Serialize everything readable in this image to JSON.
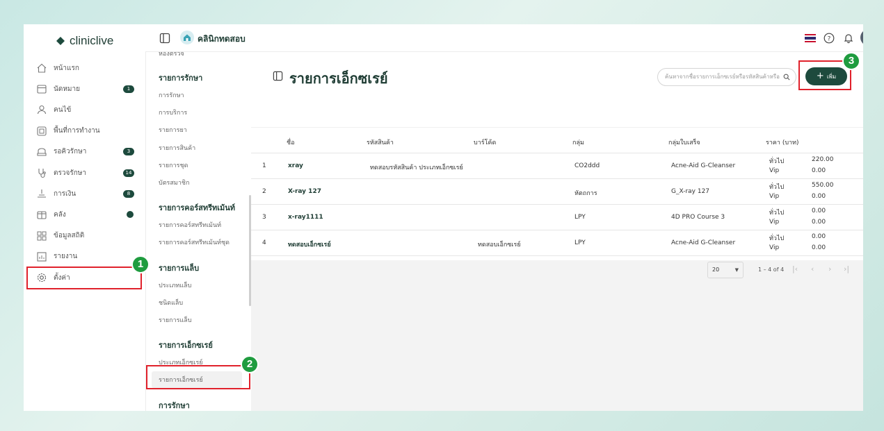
{
  "brand": {
    "name": "cliniclive"
  },
  "topbar": {
    "clinic_name": "คลินิกทดสอบ"
  },
  "sidebar": {
    "items": [
      {
        "label": "หน้าแรก",
        "icon": "home-icon",
        "badge": ""
      },
      {
        "label": "นัดหมาย",
        "icon": "calendar-icon",
        "badge": "1"
      },
      {
        "label": "คนไข้",
        "icon": "user-icon",
        "badge": ""
      },
      {
        "label": "พื้นที่การทำงาน",
        "icon": "workspace-icon",
        "badge": ""
      },
      {
        "label": "รอคิวรักษา",
        "icon": "seat-icon",
        "badge": "3"
      },
      {
        "label": "ตรวจรักษา",
        "icon": "stethoscope-icon",
        "badge": "14"
      },
      {
        "label": "การเงิน",
        "icon": "finance-icon",
        "badge": "8"
      },
      {
        "label": "คลัง",
        "icon": "storage-icon",
        "badge": ""
      },
      {
        "label": "ข้อมูลสถิติ",
        "icon": "stats-icon",
        "badge": ""
      },
      {
        "label": "รายงาน",
        "icon": "report-icon",
        "badge": ""
      },
      {
        "label": "ตั้งค่า",
        "icon": "gear-icon",
        "badge": ""
      }
    ]
  },
  "submenu": {
    "top_cut": "ห้องตรวจ",
    "sections": [
      {
        "title": "รายการรักษา",
        "items": [
          "การรักษา",
          "การบริการ",
          "รายการยา",
          "รายการสินค้า",
          "รายการชุด",
          "บัตรสมาชิก"
        ]
      },
      {
        "title": "รายการคอร์สทรีทเม้นท์",
        "items": [
          "รายการคอร์สทรีทเม้นท์",
          "รายการคอร์สทรีทเม้นท์ชุด"
        ]
      },
      {
        "title": "รายการแล็บ",
        "items": [
          "ประเภทแล็บ",
          "ชนิดแล็บ",
          "รายการแล็บ"
        ]
      },
      {
        "title": "รายการเอ็กซเรย์",
        "items": [
          "ประเภทเอ็กซเรย์",
          "รายการเอ็กซเรย์"
        ]
      },
      {
        "title": "การรักษา",
        "items": []
      }
    ]
  },
  "page": {
    "title": "รายการเอ็กซเรย์",
    "search_placeholder": "ค้นหาจากชื่อรายการเอ็กซเรย์หรือรหัสสินค้าหรือ",
    "add_label": "เพิ่ม"
  },
  "table": {
    "headers": {
      "name": "ชื่อ",
      "code": "รหัสสินค้า",
      "barcode": "บาร์โค้ด",
      "group": "กลุ่ม",
      "report_group": "กลุ่มใบเสร็จ",
      "price": "ราคา (บาท)"
    },
    "price_labels": {
      "general": "ทั่วไป",
      "vip": "Vip"
    },
    "rows": [
      {
        "no": "1",
        "name": "xray",
        "code": "ทดสอบรหัสสินค้า ประเภทเอ็กซเรย์",
        "barcode": "",
        "group": "CO2ddd",
        "report_group": "Acne-Aid G-Cleanser",
        "general": "220.00",
        "vip": "0.00"
      },
      {
        "no": "2",
        "name": "X-ray 127",
        "code": "",
        "barcode": "",
        "group": "หัตถการ",
        "report_group": "G_X-ray 127",
        "general": "550.00",
        "vip": "0.00"
      },
      {
        "no": "3",
        "name": "x-ray1111",
        "code": "",
        "barcode": "",
        "group": "LPY",
        "report_group": "4D PRO Course 3",
        "general": "0.00",
        "vip": "0.00"
      },
      {
        "no": "4",
        "name": "ทดสอบเอ็กซเรย์",
        "code": "",
        "barcode": "ทดสอบเอ็กซเรย์",
        "group": "LPY",
        "report_group": "Acne-Aid G-Cleanser",
        "general": "0.00",
        "vip": "0.00"
      }
    ]
  },
  "pagination": {
    "page_size": "20",
    "range": "1 – 4 of 4"
  },
  "steps": [
    "1",
    "2",
    "3"
  ],
  "colors": {
    "accent": "#1d4a3d",
    "highlight": "#e0212b",
    "step": "#1f9c3f"
  }
}
